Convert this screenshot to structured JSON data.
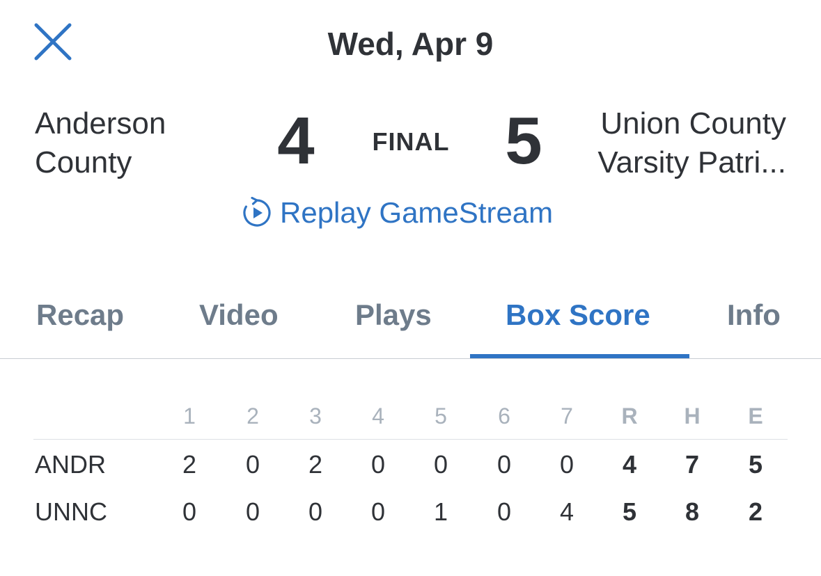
{
  "header": {
    "date": "Wed, Apr 9",
    "close_icon": "close-x-icon"
  },
  "matchup": {
    "away_team": "Anderson County",
    "away_score": "4",
    "status": "FINAL",
    "home_score": "5",
    "home_team": "Union County Varsity Patri..."
  },
  "replay": {
    "label": "Replay GameStream",
    "icon": "replay-icon"
  },
  "tabs": [
    {
      "label": "Recap"
    },
    {
      "label": "Video"
    },
    {
      "label": "Plays"
    },
    {
      "label": "Box Score",
      "active": true
    },
    {
      "label": "Info"
    }
  ],
  "box_score": {
    "columns": [
      "1",
      "2",
      "3",
      "4",
      "5",
      "6",
      "7",
      "R",
      "H",
      "E"
    ],
    "rows": [
      {
        "team": "ANDR",
        "innings": [
          "2",
          "0",
          "2",
          "0",
          "0",
          "0",
          "0"
        ],
        "R": "4",
        "H": "7",
        "E": "5"
      },
      {
        "team": "UNNC",
        "innings": [
          "0",
          "0",
          "0",
          "0",
          "1",
          "0",
          "4"
        ],
        "R": "5",
        "H": "8",
        "E": "2"
      }
    ]
  },
  "colors": {
    "accent": "#2f74c4",
    "text": "#2f3237",
    "inactive_tab": "#6e7c8b",
    "header_muted": "#a9b2bc"
  }
}
